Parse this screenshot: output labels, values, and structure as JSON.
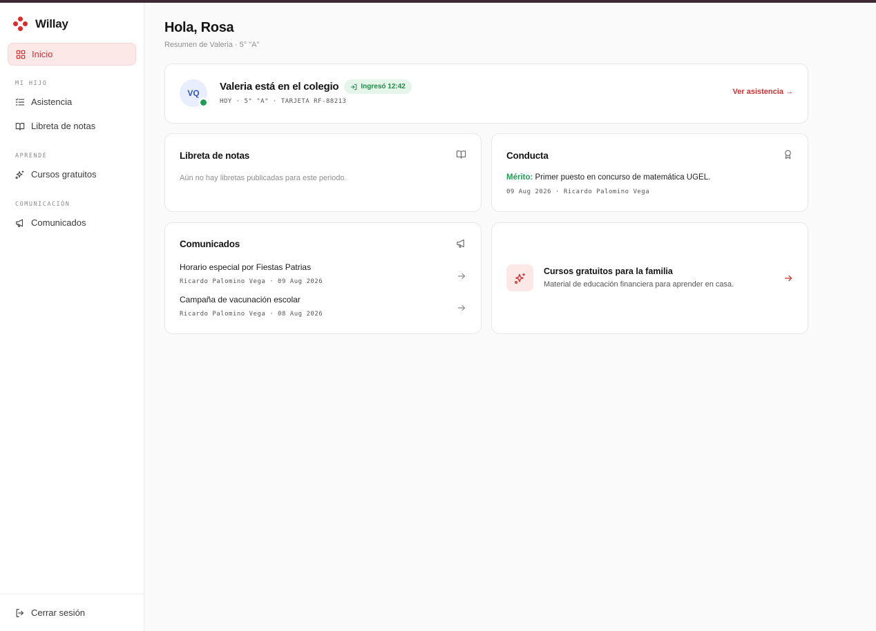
{
  "app": {
    "name": "Willay"
  },
  "sidebar": {
    "home_label": "Inicio",
    "sections": [
      {
        "title": "MI HIJO",
        "items": [
          "Asistencia",
          "Libreta de notas"
        ]
      },
      {
        "title": "APRENDE",
        "items": [
          "Cursos gratuitos"
        ]
      },
      {
        "title": "COMUNICACIÓN",
        "items": [
          "Comunicados"
        ]
      }
    ],
    "logout_label": "Cerrar sesión"
  },
  "header": {
    "title": "Hola, Rosa",
    "subtitle": "Resumen de Valeria · 5° \"A\""
  },
  "student_card": {
    "initials": "VQ",
    "status_title": "Valeria está en el colegio",
    "checkin_badge": "Ingresó 12:42",
    "meta": "HOY · 5° \"A\" · TARJETA RF-88213",
    "link_label": "Ver asistencia →"
  },
  "grades_card": {
    "title": "Libreta de notas",
    "empty_text": "Aún no hay libretas publicadas para este periodo."
  },
  "conduct_card": {
    "title": "Conducta",
    "merit_label": "Mérito:",
    "merit_text": " Primer puesto en concurso de matemática UGEL.",
    "meta": "09 Aug 2026 · Ricardo Palomino Vega"
  },
  "announcements_card": {
    "title": "Comunicados",
    "items": [
      {
        "title": "Horario especial por Fiestas Patrias",
        "meta": "Ricardo Palomino Vega · 09 Aug 2026"
      },
      {
        "title": "Campaña de vacunación escolar",
        "meta": "Ricardo Palomino Vega · 08 Aug 2026"
      }
    ]
  },
  "courses_card": {
    "title": "Cursos gratuitos para la familia",
    "description": "Material de educación financiera para aprender en casa."
  },
  "colors": {
    "accent": "#d32f2f",
    "accent_soft": "#fde8e8",
    "success": "#1f9d55",
    "topbar": "#3b2a33"
  }
}
